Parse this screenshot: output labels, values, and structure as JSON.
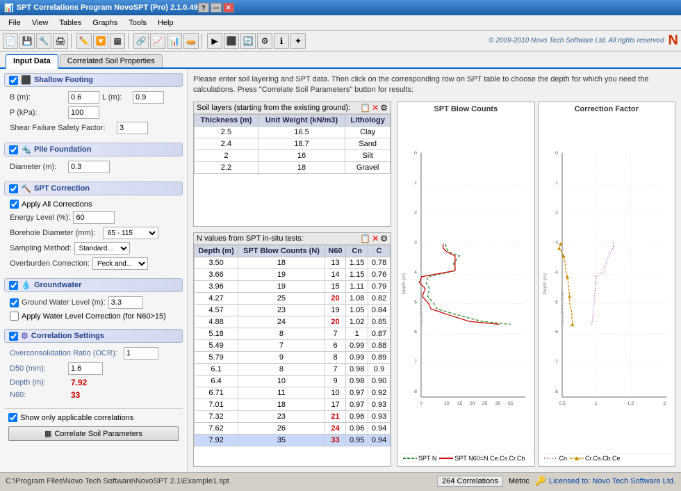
{
  "titlebar": {
    "title": "SPT Correlations Program NovoSPT (Pro) 2.1.0.49",
    "controls": [
      "?",
      "—",
      "✕"
    ]
  },
  "menubar": {
    "items": [
      "File",
      "View",
      "Tables",
      "Graphs",
      "Tools",
      "Help"
    ]
  },
  "toolbar": {
    "copyright": "© 2009-2010 Novo Tech Software Ltd. All rights reserved"
  },
  "tabs": {
    "items": [
      "Input Data",
      "Correlated Soil Properties"
    ],
    "active": "Input Data"
  },
  "instructions": "Please enter soil layering and SPT data. Then click on the corresponding row on SPT table to choose the depth for which you need the calculations. Press \"Correlate Soil Parameters\" button for results:",
  "shallow_footing": {
    "title": "Shallow Footing",
    "b_label": "B (m):",
    "b_value": "0.6",
    "l_label": "L (m):",
    "l_value": "0.9",
    "p_label": "P (kPa):",
    "p_value": "100",
    "sf_label": "Shear Failure Safety Factor:",
    "sf_value": "3"
  },
  "pile_foundation": {
    "title": "Pile Foundation",
    "diam_label": "Diameter (m):",
    "diam_value": "0.3"
  },
  "spt_correction": {
    "title": "SPT Correction",
    "apply_all": "Apply All Corrections",
    "energy_label": "Energy Level (%):",
    "energy_value": "60",
    "borehole_label": "Borehole Diameter (mm):",
    "borehole_value": "65 - 115",
    "sampling_label": "Sampling Method:",
    "sampling_value": "Standard...",
    "overburden_label": "Overburden Correction:",
    "overburden_value": "Peck and..."
  },
  "groundwater": {
    "title": "Groundwater",
    "gwl_label": "Ground Water Level (m):",
    "gwl_value": "3.3",
    "apply_water": "Apply Water Level Correction (for N60>15)"
  },
  "correlation_settings": {
    "title": "Correlation Settings",
    "ocr_label": "Overconsolidation Ratio (OCR):",
    "ocr_value": "1",
    "d50_label": "D50 (mm):",
    "d50_value": "1.6",
    "depth_label": "Depth (m):",
    "depth_value": "7.92",
    "n60_label": "N60:",
    "n60_value": "33",
    "show_applicable": "Show only applicable correlations"
  },
  "correlate_btn": "Correlate Soil Parameters",
  "soil_layers_table": {
    "label": "Soil layers (starting from the existing ground):",
    "columns": [
      "Thickness (m)",
      "Unit Weight (kN/m3)",
      "Lithology"
    ],
    "rows": [
      [
        "2.5",
        "16.5",
        "Clay"
      ],
      [
        "2.4",
        "18.7",
        "Sand"
      ],
      [
        "2",
        "16",
        "Silt"
      ],
      [
        "2.2",
        "18",
        "Gravel"
      ]
    ]
  },
  "spt_table": {
    "label": "N values from SPT in-situ tests:",
    "columns": [
      "Depth (m)",
      "SPT Blow Counts (N)",
      "N60",
      "Cn",
      "C"
    ],
    "rows": [
      [
        "3.50",
        "18",
        "13",
        "1.15",
        "0.78"
      ],
      [
        "3.66",
        "19",
        "14",
        "1.15",
        "0.76"
      ],
      [
        "3.96",
        "19",
        "15",
        "1.11",
        "0.79"
      ],
      [
        "4.27",
        "25",
        "20",
        "1.08",
        "0.82"
      ],
      [
        "4.57",
        "23",
        "19",
        "1.05",
        "0.84"
      ],
      [
        "4.88",
        "24",
        "20",
        "1.02",
        "0.85"
      ],
      [
        "5.18",
        "8",
        "7",
        "1",
        "0.87"
      ],
      [
        "5.49",
        "7",
        "6",
        "0.99",
        "0.88"
      ],
      [
        "5.79",
        "9",
        "8",
        "0.99",
        "0.89"
      ],
      [
        "6.1",
        "8",
        "7",
        "0.98",
        "0.9"
      ],
      [
        "6.4",
        "10",
        "9",
        "0.98",
        "0.90"
      ],
      [
        "6.71",
        "11",
        "10",
        "0.97",
        "0.92"
      ],
      [
        "7.01",
        "18",
        "17",
        "0.97",
        "0.93"
      ],
      [
        "7.32",
        "23",
        "21",
        "0.96",
        "0.93"
      ],
      [
        "7.62",
        "26",
        "24",
        "0.96",
        "0.94"
      ],
      [
        "7.92",
        "35",
        "33",
        "0.95",
        "0.94"
      ]
    ],
    "selected_row": 15
  },
  "chart1": {
    "title": "SPT Blow Counts",
    "x_labels": [
      "0",
      "10",
      "15",
      "20",
      "25",
      "30",
      "35"
    ],
    "y_label": "Depth (m)",
    "y_min": 0,
    "y_max": 8
  },
  "chart2": {
    "title": "Correction Factor",
    "x_labels": [
      "0.5",
      "1",
      "1.5",
      "2"
    ],
    "y_label": "Depth (m)",
    "y_min": 0,
    "y_max": 8
  },
  "legend": {
    "items": [
      {
        "label": "SPT N",
        "color": "#228B22",
        "style": "dashed"
      },
      {
        "label": "SPT N60=N.Ce.Cs.Cr.Cb",
        "color": "#cc0000",
        "style": "solid"
      },
      {
        "label": "Cn",
        "color": "#9900cc",
        "style": "dotted"
      },
      {
        "label": "Cr.Cs.Cb.Ce",
        "color": "#cc8800",
        "style": "dashed-triangle"
      }
    ]
  },
  "statusbar": {
    "path": "C:\\Program Files\\Novo Tech Software\\NovoSPT 2.1\\Example1.spt",
    "correlations": "264 Correlations",
    "metric": "Metric",
    "license": "Licensed to: Novo Tech Software Ltd."
  },
  "version_watermark": "NovoSPT 2.1.0.49"
}
